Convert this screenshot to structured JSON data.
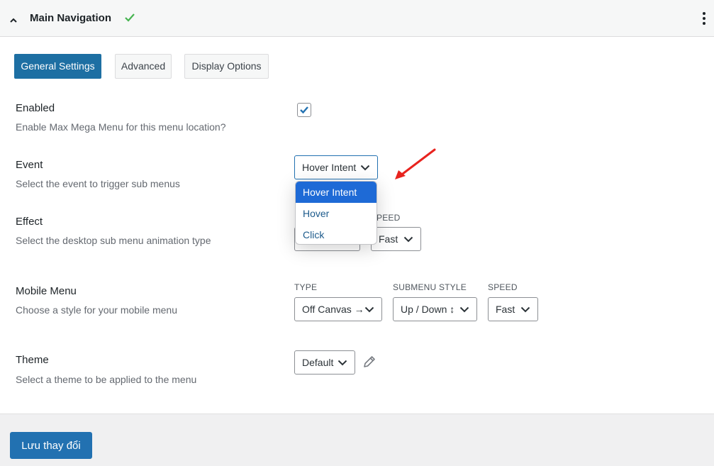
{
  "header": {
    "title": "Main Navigation",
    "collapse_icon": "chevron-up-icon",
    "status_icon": "checkmark-icon",
    "status_color": "#46b450",
    "menu_icon": "kebab-menu-icon"
  },
  "tabs": [
    {
      "label": "General Settings",
      "active": true
    },
    {
      "label": "Advanced",
      "active": false
    },
    {
      "label": "Display Options",
      "active": false
    }
  ],
  "enabled": {
    "label": "Enabled",
    "description": "Enable Max Mega Menu for this menu location?",
    "checked": true
  },
  "event": {
    "label": "Event",
    "description": "Select the event to trigger sub menus",
    "selected": "Hover Intent",
    "options": [
      "Hover Intent",
      "Hover",
      "Click"
    ]
  },
  "effect": {
    "label": "Effect",
    "description": "Select the desktop sub menu animation type",
    "speed_label": "PEED",
    "speed_value": "Fast"
  },
  "mobile_menu": {
    "label": "Mobile Menu",
    "description": "Choose a style for your mobile menu",
    "type_label": "TYPE",
    "type_value": "Off Canvas →",
    "submenu_style_label": "SUBMENU STYLE",
    "submenu_style_value": "Up / Down ↕",
    "speed_label": "SPEED",
    "speed_value": "Fast"
  },
  "theme": {
    "label": "Theme",
    "description": "Select a theme to be applied to the menu",
    "value": "Default",
    "edit_icon": "pencil-icon"
  },
  "save_button": "Lưu thay đổi",
  "colors": {
    "primary": "#2271b1",
    "tab_active": "#1d6fa3",
    "dropdown_selected": "#1e6ad6",
    "annotation_arrow": "#e8231e"
  }
}
